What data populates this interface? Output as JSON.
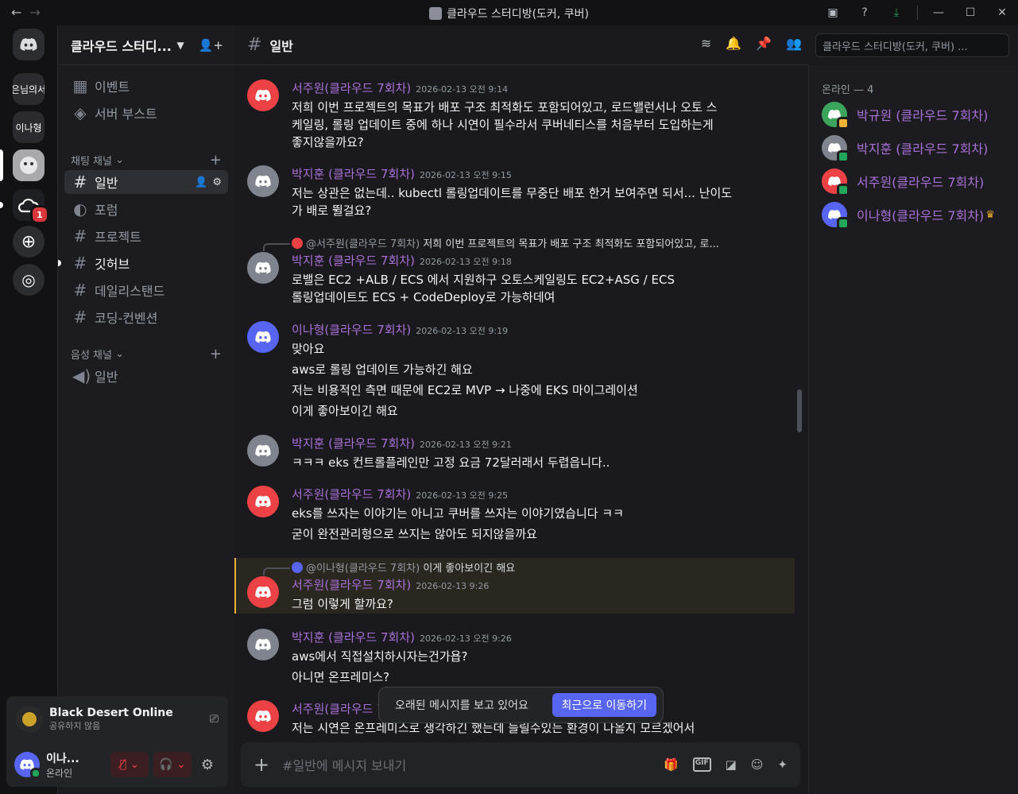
{
  "window": {
    "title": "클라우드 스터디방(도커, 쿠버)"
  },
  "guilds": {
    "g1_text": "은님의서",
    "g2_text": "이나형",
    "g4_badge": "1"
  },
  "server": {
    "name": "클라우드 스터디...",
    "top_items": [
      "이벤트",
      "서버 부스트"
    ],
    "text_category": "채팅 채널",
    "text_channels": [
      "일반",
      "포럼",
      "프로젝트",
      "깃허브",
      "데일리스탠드",
      "코딩-컨벤션"
    ],
    "voice_category": "음성 채널",
    "voice_channels": [
      "일반"
    ]
  },
  "activity": {
    "game": "Black Desert Online",
    "status": "공유하지 않음"
  },
  "user": {
    "name": "이나...",
    "status": "온라인"
  },
  "chat": {
    "channel": "일반",
    "search_placeholder": "클라우드 스터디방(도커, 쿠버) ...",
    "composer_placeholder": "#일반에 메시지 보내기",
    "jump_text": "오래된 메시지를 보고 있어요",
    "jump_button": "최근으로 이동하기",
    "messages": [
      {
        "author": "서주원(클라우드 7회차)",
        "time": "2026-02-13 오전 9:14",
        "lines": [
          "저희 이번 프로젝트의 목표가 배포 구조 최적화도 포함되어있고, 로드밸런서나 오토 스",
          "케일링, 롤링 업데이트 중에 하나 시연이 필수라서 쿠버네티스를 처음부터 도입하는게",
          "좋지않을까요?"
        ]
      },
      {
        "author": "박지훈 (클라우드 7회차)",
        "time": "2026-02-13 오전 9:15",
        "lines": [
          "저는 상관은 없는데.. kubectl 롤링업데이트를 무중단 배포 한거 보여주면 되서... 난이도",
          "가 배로 뛸걸요?"
        ]
      },
      {
        "reply_author": "@서주원(클라우드 7회차)",
        "reply_text": "저희 이번 프로젝트의 목표가 배포 구조 최적화도 포함되어있고, 로...",
        "author": "박지훈 (클라우드 7회차)",
        "time": "2026-02-13 오전 9:18",
        "lines": [
          "로밸은 EC2 +ALB / ECS 에서 지원하구 오토스케일링도 EC2+ASG / ECS",
          "롤링업데이트도 ECS + CodeDeploy로 가능하데여"
        ]
      },
      {
        "author": "이나형(클라우드 7회차)",
        "time": "2026-02-13 오전 9:19",
        "lines": [
          "맞아요",
          "aws로 롤링 업데이트 가능하긴 해요",
          "저는 비용적인 측면 때문에 EC2로 MVP → 나중에 EKS 마이그레이션",
          "이게 좋아보이긴 해요"
        ]
      },
      {
        "author": "박지훈 (클라우드 7회차)",
        "time": "2026-02-13 오전 9:21",
        "lines": [
          "ㅋㅋㅋ eks 컨트롤플레인만 고정 요금 72달러래서 두렵읍니다.."
        ]
      },
      {
        "author": "서주원(클라우드 7회차)",
        "time": "2026-02-13 오전 9:25",
        "lines": [
          "eks를 쓰자는 이야기는 아니고 쿠버를 쓰자는 이야기였습니다 ㅋㅋ",
          "굳이 완전관리형으로 쓰지는 않아도 되지않을까요"
        ]
      },
      {
        "reply_author": "@이나형(클라우드 7회차)",
        "reply_text": "이게 좋아보이긴 해요",
        "author": "서주원(클라우드 7회차)",
        "time": "2026-02-13 9:26",
        "lines": [
          "그럼 이렇게 할까요?"
        ]
      },
      {
        "author": "박지훈 (클라우드 7회차)",
        "time": "2026-02-13 오전 9:26",
        "lines": [
          "aws에서 직접설치하시자는건가욥?",
          "아니면 온프레미스?"
        ]
      },
      {
        "author": "서주원(클라우드 7회차)",
        "time": "",
        "lines": [
          "저는 시연은 온프레미스로 생각하긴 했는데 늘릴수있는 환경이 나올지 모르겠어서"
        ]
      }
    ]
  },
  "members": {
    "header": "온라인 — 4",
    "list": [
      {
        "name": "박규원 (클라우드 7회차)",
        "color": "#3ba55c",
        "status": "idle"
      },
      {
        "name": "박지훈 (클라우드 7회차)",
        "color": "#80848e",
        "status": "online"
      },
      {
        "name": "서주원(클라우드 7회차)",
        "color": "#ed4245",
        "status": "online"
      },
      {
        "name": "이나형(클라우드 7회차)",
        "color": "#5865f2",
        "status": "online"
      }
    ]
  },
  "colors": {
    "red_avatar": "#ed4245",
    "gray_avatar": "#80848e",
    "blue_avatar": "#5865f2",
    "author_purple": "#a970d6",
    "accent": "#5865f2"
  }
}
